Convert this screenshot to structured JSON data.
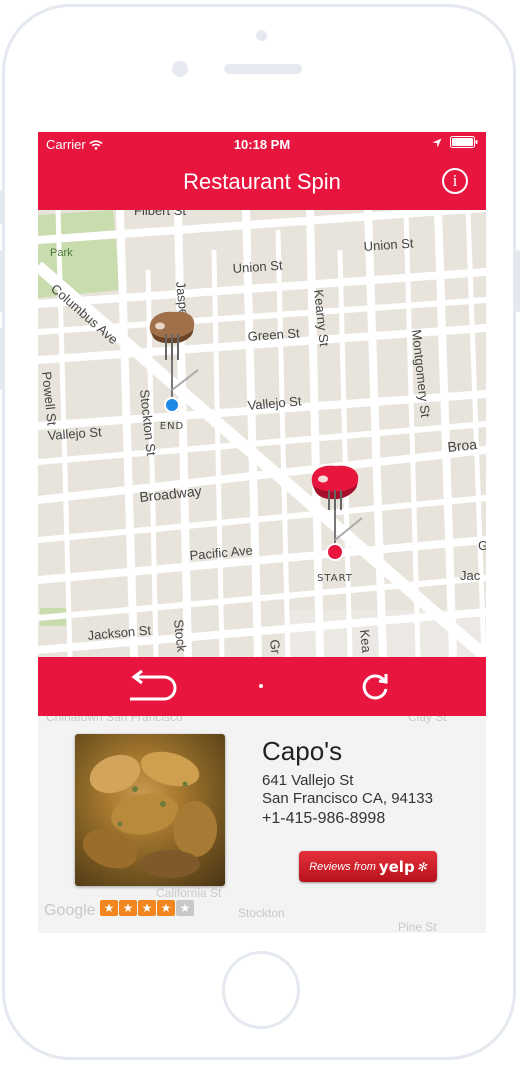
{
  "status_bar": {
    "carrier": "Carrier",
    "time": "10:18 PM"
  },
  "nav": {
    "title": "Restaurant Spin",
    "info_icon": "i"
  },
  "map": {
    "streets": [
      "Filbert St",
      "Park",
      "Union St",
      "Columbus Ave",
      "Jasper Pl",
      "Green St",
      "Kearny St",
      "Montgomery St",
      "Powell St",
      "Stockton St",
      "Vallejo St",
      "Vallejo St",
      "Broadway",
      "Broa",
      "Pacific Ave",
      "Jackson St",
      "Stock",
      "G",
      "Jac",
      "Kea",
      "Gr",
      "Chinatown San Francisco"
    ],
    "end_label": "END",
    "start_label": "START"
  },
  "toolbar": {
    "back_icon": "back-arrow-icon",
    "refresh_icon": "refresh-icon"
  },
  "restaurant": {
    "name": "Capo's",
    "address_line1": "641 Vallejo St",
    "address_line2": "San Francisco CA, 94133",
    "phone": "+1-415-986-8998",
    "rating": 4,
    "rating_max": 5,
    "yelp_prefix": "Reviews from",
    "yelp_brand": "yelp"
  },
  "detail_map_text": {
    "google": "Google",
    "clay": "Clay St",
    "pine": "Pine St",
    "california": "California St",
    "stockton": "Stockton"
  },
  "colors": {
    "brand": "#e8163f",
    "end_pin": "#1e88e5",
    "start_pin": "#e8163f"
  }
}
